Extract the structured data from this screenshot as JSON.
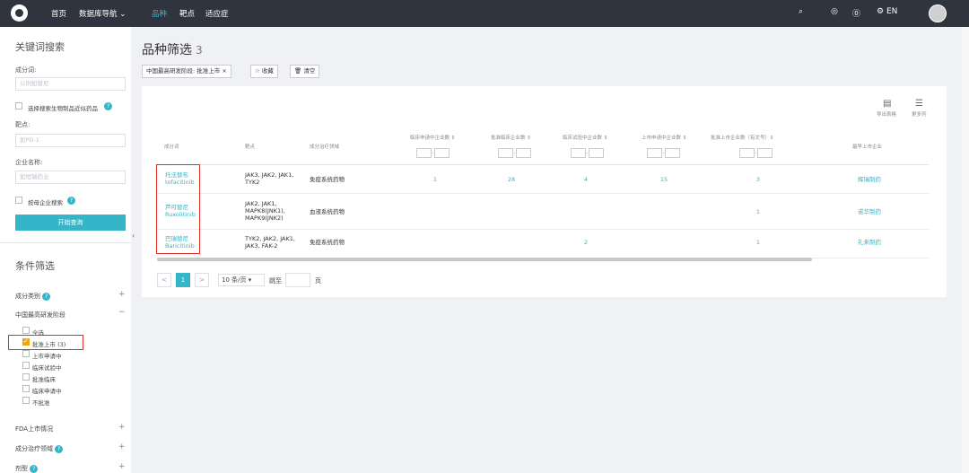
{
  "nav": {
    "home": "首页",
    "database_nav": "数据库导航",
    "tab_drug": "品种",
    "tab_target": "靶点",
    "tab_indication": "适应症",
    "lang": "EN",
    "icons": [
      "search-icon",
      "bulb-icon",
      "help-icon",
      "settings-icon",
      "user-avatar"
    ]
  },
  "sidebar": {
    "keyword_title": "关键词搜索",
    "ingredient_label": "成分词:",
    "ingredient_placeholder": "以例如替尼",
    "include_bio_label": "选择搜索生物制品近似药品",
    "target_label": "靶点:",
    "target_placeholder": "如PD-1",
    "company_label": "企业名称:",
    "company_placeholder": "如恒瑞药业",
    "by_company_label": "按母企业搜索",
    "search_button": "开始查询",
    "filter_title": "条件筛选",
    "filters": {
      "ingredient_category": "成分类别",
      "china_stage": "中国最高研发阶段",
      "stage_options": [
        {
          "label": "全选",
          "checked": false
        },
        {
          "label": "批准上市 (3)",
          "checked": true
        },
        {
          "label": "上市申请中",
          "checked": false
        },
        {
          "label": "临床试验中",
          "checked": false
        },
        {
          "label": "批准临床",
          "checked": false
        },
        {
          "label": "临床申请中",
          "checked": false
        },
        {
          "label": "不批准",
          "checked": false
        }
      ],
      "fda": "FDA上市情况",
      "therapeutic_area": "成分治疗领域",
      "dosage_form": "剂型"
    }
  },
  "main": {
    "title": "品种筛选",
    "count": "3",
    "chip_filter": "中国最高研发阶段: 批准上市 ×",
    "chip_favorite": "☆ 收藏",
    "chip_clear": "🗑 清空",
    "export_label": "导出表格",
    "more_columns_label": "更多列",
    "columns": [
      "成分词",
      "靶点",
      "成分治疗领域",
      "临床申请中企业数 ⇕",
      "批准临床企业数 ⇕",
      "临床试验中企业数 ⇕",
      "上市申请中企业数 ⇕",
      "批准上市企业数（有文号）⇕",
      "最早上市企业"
    ],
    "rows": [
      {
        "cn": "托法替布",
        "en": "tofacitinib",
        "target": "JAK3, JAK2, JAK1, TYK2",
        "area": "免疫系统药物",
        "c1": "1",
        "c2": "28",
        "c3": "4",
        "c4": "15",
        "c5": "3",
        "first": "辉瑞制药"
      },
      {
        "cn": "芦可替尼",
        "en": "Ruxolitinib",
        "target": "JAK2, JAK1, MAPK8(JNK1), MAPK9(JNK2)",
        "area": "血液系统药物",
        "c1": "",
        "c2": "",
        "c3": "",
        "c4": "",
        "c5": "1",
        "first": "诺华制药"
      },
      {
        "cn": "巴瑞替尼",
        "en": "Baricitinib",
        "target": "TYK2, JAK2, JAK1, JAK3, FAK-2",
        "area": "免疫系统药物",
        "c1": "",
        "c2": "",
        "c3": "2",
        "c4": "",
        "c5": "1",
        "first": "礼来制药"
      }
    ],
    "pagination": {
      "prev": "<",
      "page": "1",
      "next": ">",
      "page_size": "10 条/页 ▾",
      "goto_label": "跳至",
      "page_suffix": "页"
    }
  }
}
